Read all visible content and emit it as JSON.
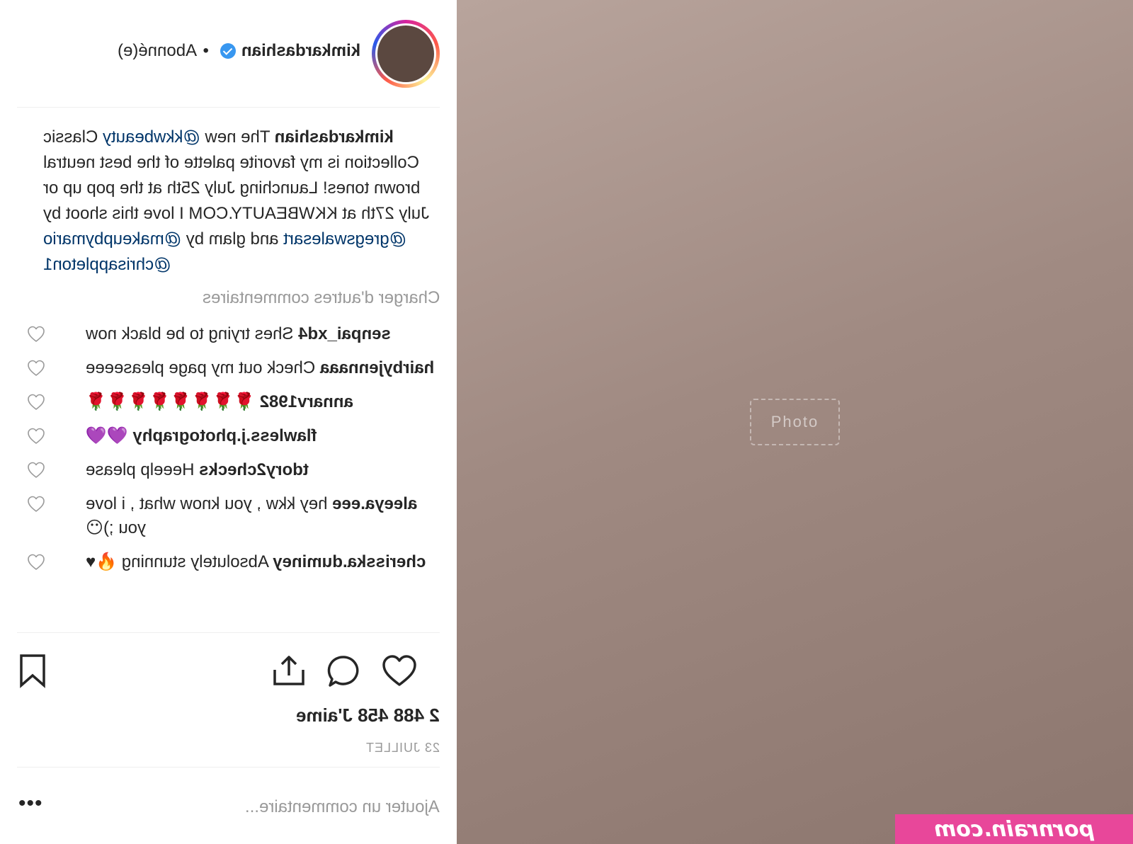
{
  "post": {
    "username": "kimkardashian",
    "follow_status": "Abonné(e)",
    "separator": "•",
    "photo_placeholder": "Photo"
  },
  "caption": {
    "username": "kimkardashian",
    "text_1": " The new ",
    "mention_1": "@kkwbeauty",
    "text_2": " Classic Collection is my favorite palette of the best neutral brown tones! Launching July 25th at the pop up or July 27th at KKWBEAUTY.COM I love this shoot by ",
    "mention_2": "@gregswalesart",
    "text_3": " and glam by ",
    "mention_3": "@makeupbymario",
    "text_4": " ",
    "mention_4": "@chrisappleton1"
  },
  "load_more": "Charger d'autres commentaires",
  "comments": [
    {
      "user": "senpai_xd4",
      "text": " Shes trying to be black now"
    },
    {
      "user": "hairbyjennaaa",
      "text": " Check out my page pleaseeee"
    },
    {
      "user": "annarv1982",
      "text": " 🌹🌹🌹🌹🌹🌹🌹🌹"
    },
    {
      "user": "flawless.j.photography",
      "text": " 💜💜"
    },
    {
      "user": "tdory2checks",
      "text": " Heeelp please"
    },
    {
      "user": "aleeya.eee",
      "text": " hey kkw , you know what , i love you ;)😶"
    },
    {
      "user": "cherisska.duminey",
      "text": " Absolutely stunning 🔥♥"
    }
  ],
  "likes": "2 488 458 J'aime",
  "date": "23 JUILLET",
  "add_comment_placeholder": "Ajouter un commentaire...",
  "more_label": "•••",
  "watermark": "pornrain.com",
  "colors": {
    "mention": "#003569",
    "verified": "#3897f0",
    "muted": "#999999",
    "watermark_bg": "#e8479a"
  }
}
